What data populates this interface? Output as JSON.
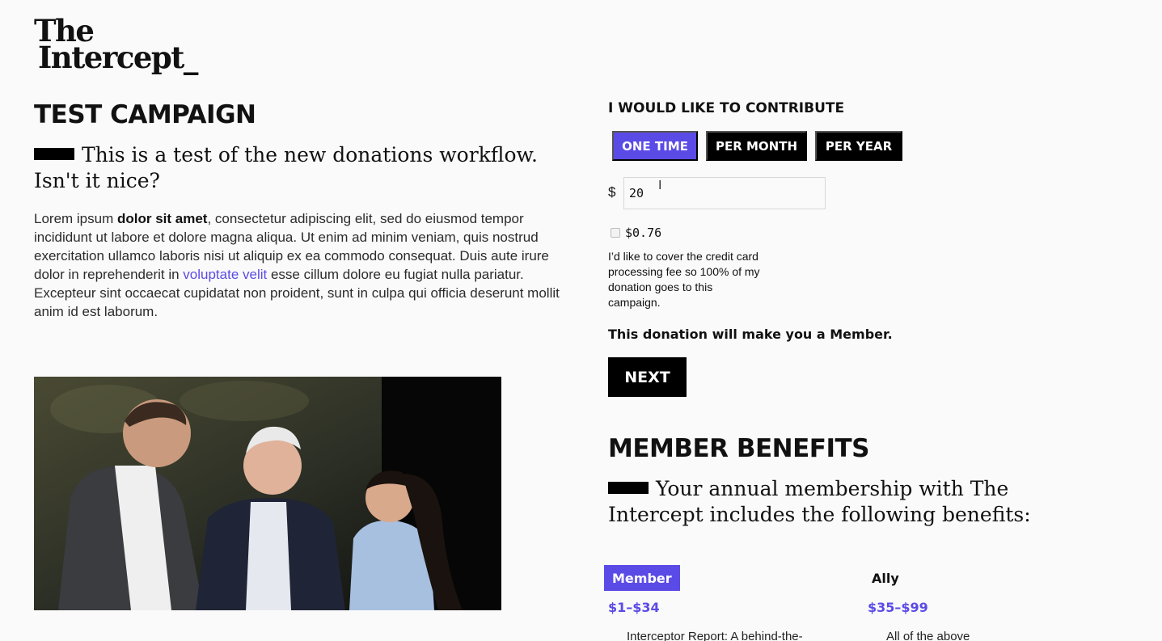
{
  "logo": {
    "line1": "The",
    "line2": "Intercept_"
  },
  "campaign": {
    "title": "TEST CAMPAIGN",
    "lede": "This is a test of the new donations workflow. Isn't it nice?",
    "body_before_bold": "Lorem ipsum ",
    "body_bold": "dolor sit amet",
    "body_middle": ", consectetur adipiscing elit, sed do eiusmod tempor incididunt ut labore et dolore magna aliqua. Ut enim ad minim veniam, quis nostrud exercitation ullamco laboris nisi ut aliquip ex ea commodo consequat. Duis aute irure dolor in reprehenderit in ",
    "body_link": "voluptate velit",
    "body_after_link": " esse cillum dolore eu fugiat nulla pariatur. Excepteur sint occaecat cupidatat non proident, sunt in culpa qui officia deserunt mollit anim id est laborum."
  },
  "contribute": {
    "label": "I WOULD LIKE TO CONTRIBUTE",
    "frequencies": [
      "ONE TIME",
      "PER MONTH",
      "PER YEAR"
    ],
    "active_frequency": "ONE TIME",
    "currency_symbol": "$",
    "amount": "20",
    "fee_amount": "$0.76",
    "fee_checked": false,
    "fee_text": "I’d like to cover the credit card processing fee so 100% of my donation goes to this campaign.",
    "member_note": "This donation will make you a Member.",
    "next_label": "NEXT"
  },
  "benefits": {
    "title": "MEMBER BENEFITS",
    "lede": "Your annual membership with The Intercept includes the following benefits:",
    "tiers": [
      {
        "name": "Member",
        "range": "$1–$34",
        "desc": "Interceptor Report: A behind-the-"
      },
      {
        "name": "Ally",
        "range": "$35–$99",
        "desc": "All of the above"
      }
    ]
  },
  "colors": {
    "accent": "#5b4be6",
    "black": "#000000",
    "background": "#fafafa"
  }
}
